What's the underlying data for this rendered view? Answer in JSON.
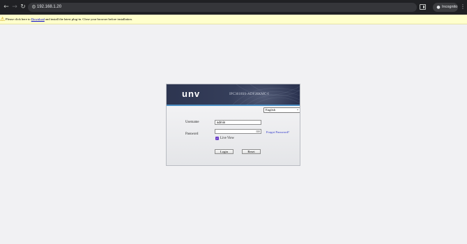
{
  "browser": {
    "url": "192.168.1.20",
    "incognito_label": "Incognito",
    "back_icon": "back-arrow-icon",
    "forward_icon": "forward-arrow-icon",
    "reload_icon": "reload-icon",
    "site_info_icon": "site-info-icon",
    "menu_icon": "kebab-menu-icon"
  },
  "plugin_bar": {
    "prefix": "Please click here to ",
    "link_text": "Download",
    "suffix": " and install the latest plug-in. Close your browser before installation."
  },
  "login": {
    "logo": "unv",
    "model": "IPC3618SS-ADF28KMC-I",
    "language": {
      "selected": "English"
    },
    "username_label": "Username",
    "username_value": "admin",
    "password_label": "Password",
    "password_value": "",
    "forgot_password": "Forgot Password?",
    "live_view_label": "Live View",
    "live_view_checked": true,
    "login_button": "Login",
    "reset_button": "Reset"
  },
  "colors": {
    "banner": "#2d3550",
    "accent_line": "#4c8fc4",
    "checkbox": "#6b3ec8",
    "link": "#2b34c9",
    "warning_bar": "#ffffcc"
  }
}
